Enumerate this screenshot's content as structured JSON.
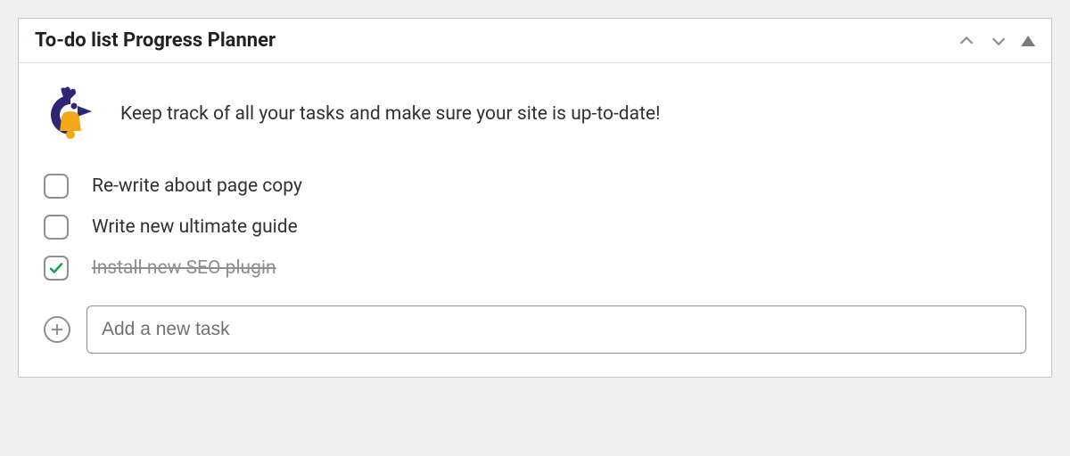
{
  "widget": {
    "title": "To-do list Progress Planner",
    "intro_text": "Keep track of all your tasks and make sure your site is up-to-date!"
  },
  "tasks": [
    {
      "label": "Re-write about page copy",
      "done": false
    },
    {
      "label": "Write new ultimate guide",
      "done": false
    },
    {
      "label": "Install new SEO plugin",
      "done": true
    }
  ],
  "add_task": {
    "placeholder": "Add a new task"
  }
}
